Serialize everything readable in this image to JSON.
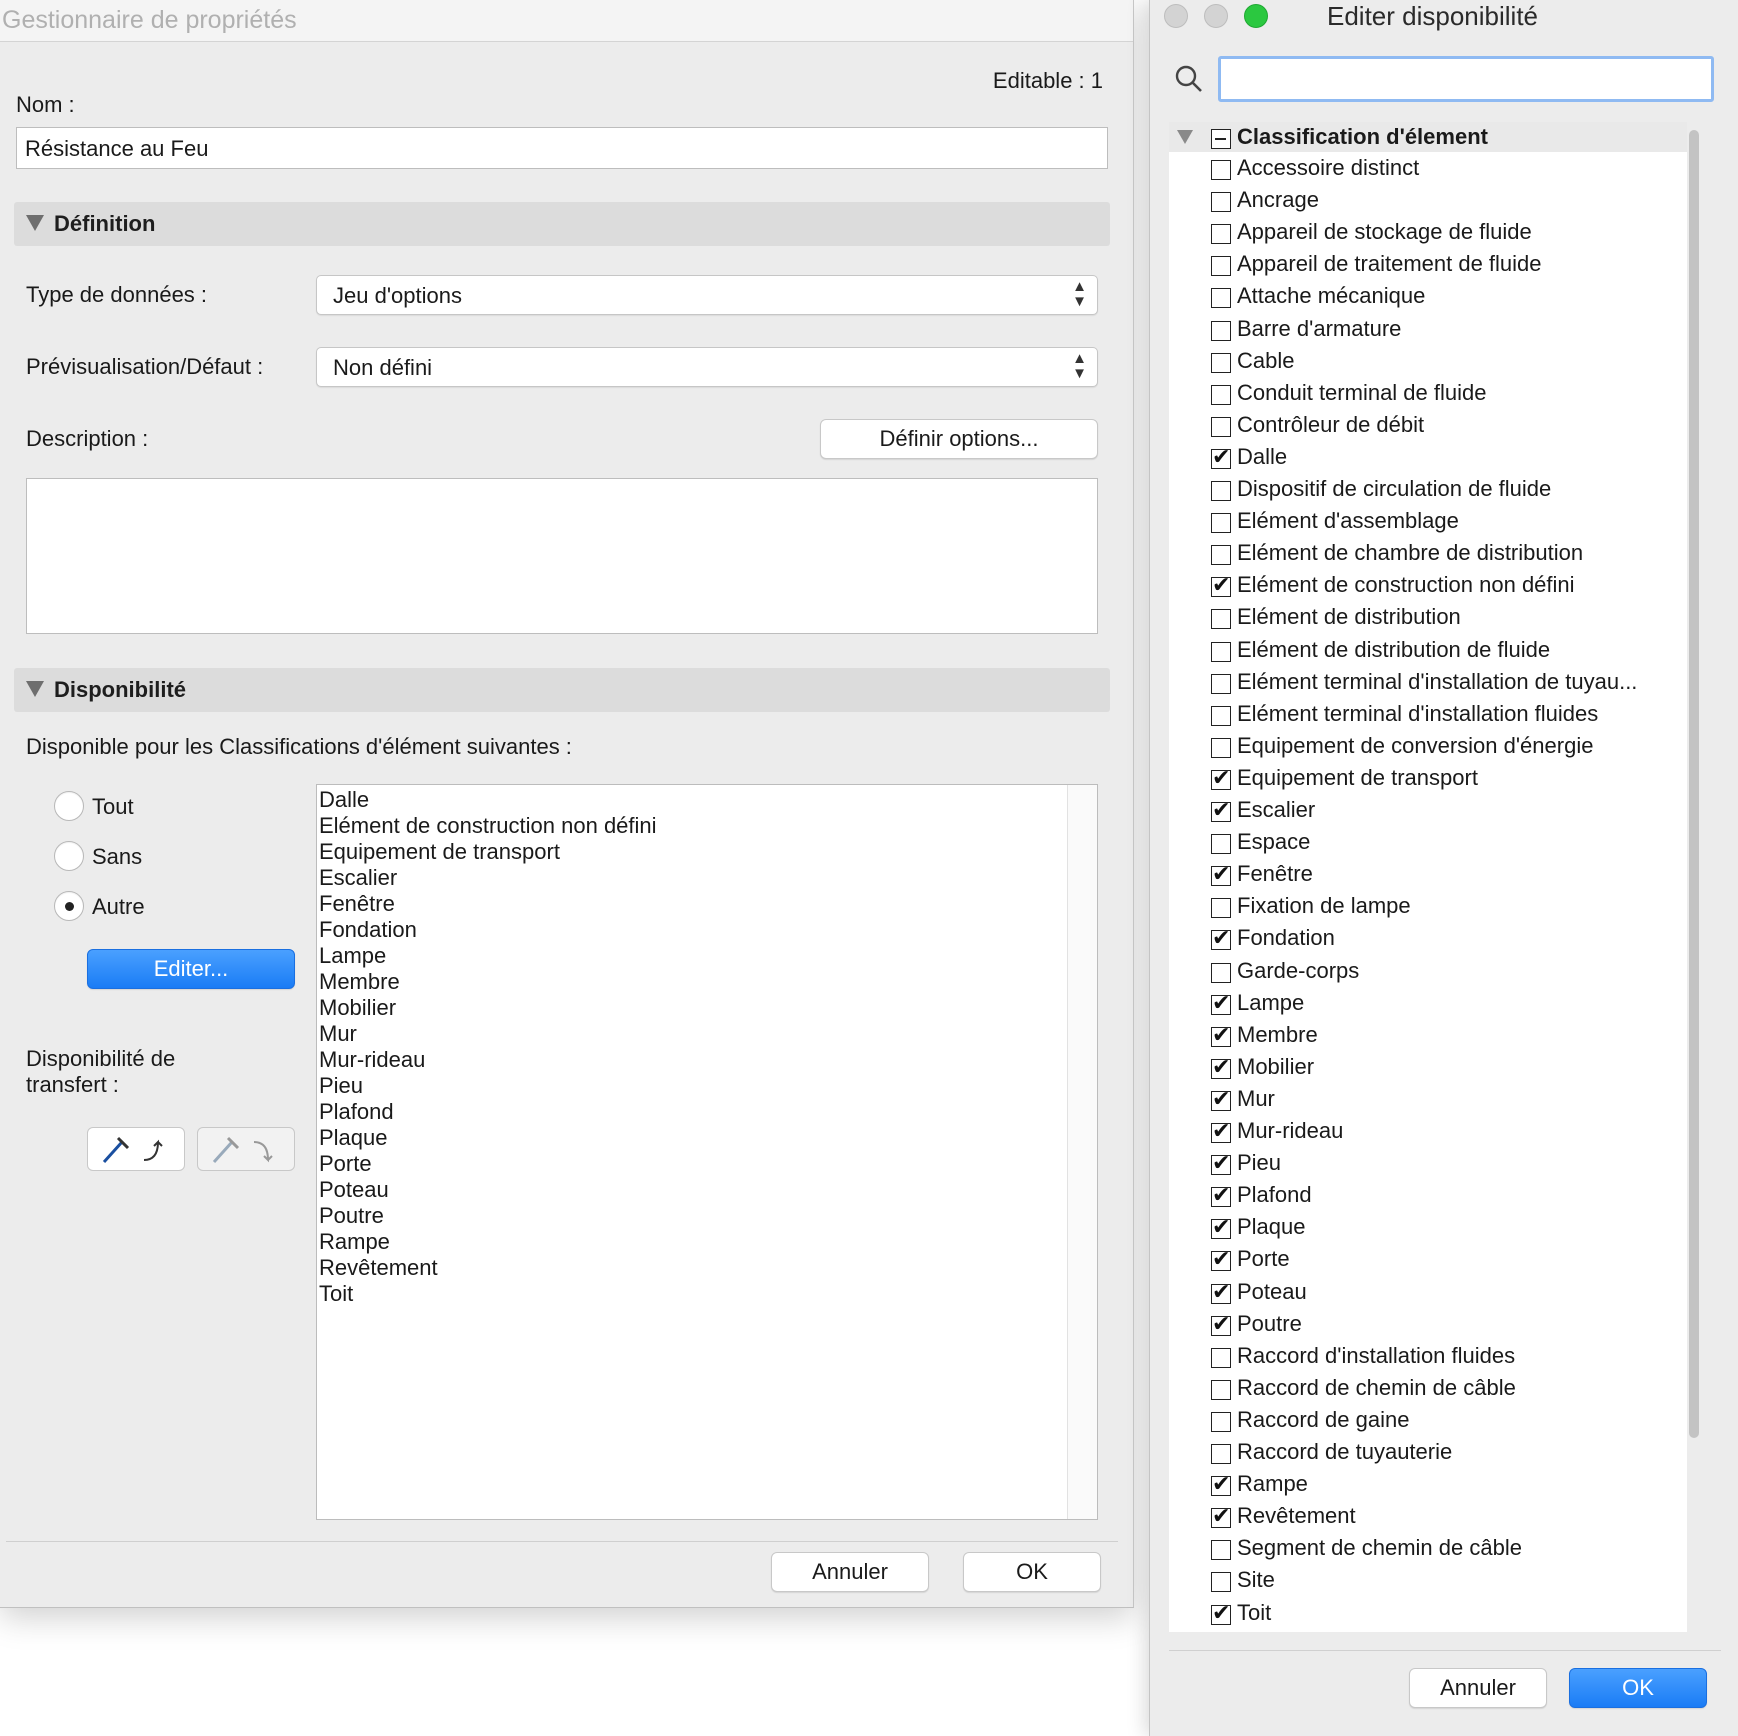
{
  "left_window": {
    "title": "Gestionnaire de propriétés",
    "editable_label": "Editable : 1",
    "name_label": "Nom :",
    "name_value": "Résistance au Feu",
    "definition": {
      "header": "Définition",
      "data_type_label": "Type de données :",
      "data_type_value": "Jeu d'options",
      "preview_label": "Prévisualisation/Défaut :",
      "preview_value": "Non défini",
      "description_label": "Description :",
      "define_options_button": "Définir options..."
    },
    "availability": {
      "header": "Disponibilité",
      "intro": "Disponible pour les Classifications d'élément suivantes :",
      "radio_all": "Tout",
      "radio_none": "Sans",
      "radio_other": "Autre",
      "selected_radio": "Autre",
      "edit_button": "Editer...",
      "transfer_label_line1": "Disponibilité de",
      "transfer_label_line2": "transfert :",
      "items": [
        "Dalle",
        "Elément de construction non défini",
        "Equipement de transport",
        "Escalier",
        "Fenêtre",
        "Fondation",
        "Lampe",
        "Membre",
        "Mobilier",
        "Mur",
        "Mur-rideau",
        "Pieu",
        "Plafond",
        "Plaque",
        "Porte",
        "Poteau",
        "Poutre",
        "Rampe",
        "Revêtement",
        "Toit"
      ]
    },
    "cancel_button": "Annuler",
    "ok_button": "OK"
  },
  "right_window": {
    "title": "Editer disponibilité",
    "search_value": "",
    "group_label": "Classification d'élement",
    "items": [
      {
        "label": "Accessoire distinct",
        "checked": false
      },
      {
        "label": "Ancrage",
        "checked": false
      },
      {
        "label": "Appareil de stockage de fluide",
        "checked": false
      },
      {
        "label": "Appareil de traitement de fluide",
        "checked": false
      },
      {
        "label": "Attache mécanique",
        "checked": false
      },
      {
        "label": "Barre d'armature",
        "checked": false
      },
      {
        "label": "Cable",
        "checked": false
      },
      {
        "label": "Conduit terminal de fluide",
        "checked": false
      },
      {
        "label": "Contrôleur de débit",
        "checked": false
      },
      {
        "label": "Dalle",
        "checked": true
      },
      {
        "label": "Dispositif de circulation de fluide",
        "checked": false
      },
      {
        "label": "Elément d'assemblage",
        "checked": false
      },
      {
        "label": "Elément de chambre de distribution",
        "checked": false
      },
      {
        "label": "Elément de construction non défini",
        "checked": true
      },
      {
        "label": "Elément de distribution",
        "checked": false
      },
      {
        "label": "Elément de distribution de fluide",
        "checked": false
      },
      {
        "label": "Elément terminal d'installation de tuyau...",
        "checked": false
      },
      {
        "label": "Elément terminal d'installation fluides",
        "checked": false
      },
      {
        "label": "Equipement de conversion d'énergie",
        "checked": false
      },
      {
        "label": "Equipement de transport",
        "checked": true
      },
      {
        "label": "Escalier",
        "checked": true
      },
      {
        "label": "Espace",
        "checked": false
      },
      {
        "label": "Fenêtre",
        "checked": true
      },
      {
        "label": "Fixation de lampe",
        "checked": false
      },
      {
        "label": "Fondation",
        "checked": true
      },
      {
        "label": "Garde-corps",
        "checked": false
      },
      {
        "label": "Lampe",
        "checked": true
      },
      {
        "label": "Membre",
        "checked": true
      },
      {
        "label": "Mobilier",
        "checked": true
      },
      {
        "label": "Mur",
        "checked": true
      },
      {
        "label": "Mur-rideau",
        "checked": true
      },
      {
        "label": "Pieu",
        "checked": true
      },
      {
        "label": "Plafond",
        "checked": true
      },
      {
        "label": "Plaque",
        "checked": true
      },
      {
        "label": "Porte",
        "checked": true
      },
      {
        "label": "Poteau",
        "checked": true
      },
      {
        "label": "Poutre",
        "checked": true
      },
      {
        "label": "Raccord d'installation fluides",
        "checked": false
      },
      {
        "label": "Raccord de chemin de câble",
        "checked": false
      },
      {
        "label": "Raccord de gaine",
        "checked": false
      },
      {
        "label": "Raccord de tuyauterie",
        "checked": false
      },
      {
        "label": "Rampe",
        "checked": true
      },
      {
        "label": "Revêtement",
        "checked": true
      },
      {
        "label": "Segment de chemin de câble",
        "checked": false
      },
      {
        "label": "Site",
        "checked": false
      },
      {
        "label": "Toit",
        "checked": true
      }
    ],
    "cancel_button": "Annuler",
    "ok_button": "OK"
  },
  "colors": {
    "accent_blue": "#1a7cf5",
    "traffic_close": "#d0d0d0",
    "traffic_min": "#d0d0d0",
    "traffic_max": "#2bc840"
  }
}
